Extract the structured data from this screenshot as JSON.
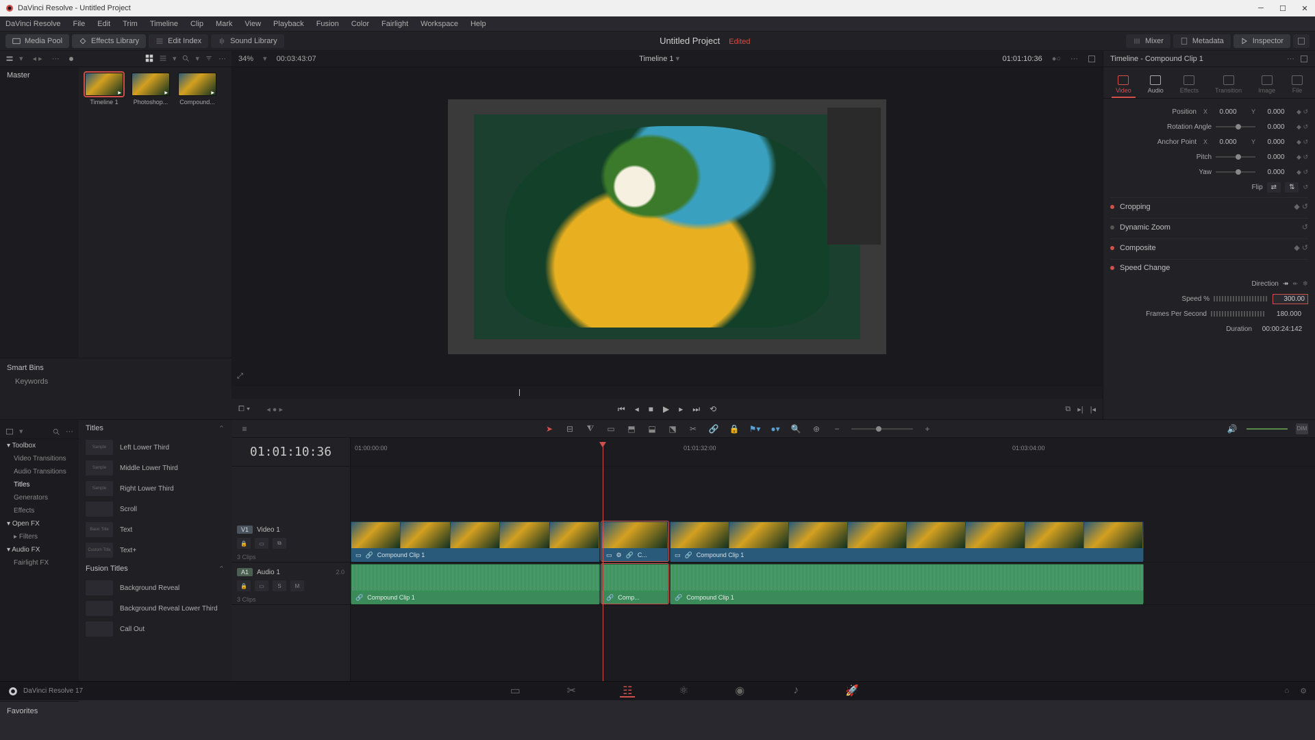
{
  "window": {
    "title": "DaVinci Resolve - Untitled Project"
  },
  "menus": [
    "DaVinci Resolve",
    "File",
    "Edit",
    "Trim",
    "Timeline",
    "Clip",
    "Mark",
    "View",
    "Playback",
    "Fusion",
    "Color",
    "Fairlight",
    "Workspace",
    "Help"
  ],
  "toolbar": {
    "media_pool": "Media Pool",
    "effects_library": "Effects Library",
    "edit_index": "Edit Index",
    "sound_library": "Sound Library",
    "project_title": "Untitled Project",
    "edited": "Edited",
    "mixer": "Mixer",
    "metadata": "Metadata",
    "inspector": "Inspector"
  },
  "media_pool": {
    "master": "Master",
    "zoom": "34%",
    "src_tc": "00:03:43:07",
    "clips": [
      {
        "name": "Timeline 1",
        "sel": true
      },
      {
        "name": "Photoshop..."
      },
      {
        "name": "Compound..."
      }
    ],
    "smartbins": "Smart Bins",
    "keywords": "Keywords"
  },
  "viewer": {
    "timeline_name": "Timeline 1",
    "rec_tc": "01:01:10:36"
  },
  "inspector": {
    "header": "Timeline - Compound Clip 1",
    "tabs": [
      "Video",
      "Audio",
      "Effects",
      "Transition",
      "Image",
      "File"
    ],
    "props": {
      "position": "Position",
      "pos_x": "0.000",
      "pos_y": "0.000",
      "rotation": "Rotation Angle",
      "rot_v": "0.000",
      "anchor": "Anchor Point",
      "anc_x": "0.000",
      "anc_y": "0.000",
      "pitch": "Pitch",
      "pitch_v": "0.000",
      "yaw": "Yaw",
      "yaw_v": "0.000",
      "flip": "Flip"
    },
    "sections": {
      "cropping": "Cropping",
      "dynamic_zoom": "Dynamic Zoom",
      "composite": "Composite",
      "speed_change": "Speed Change"
    },
    "speed": {
      "direction": "Direction",
      "speed_pct": "Speed %",
      "speed_val": "300.00",
      "fps": "Frames Per Second",
      "fps_val": "180.000",
      "duration": "Duration",
      "duration_val": "00:00:24:142"
    }
  },
  "fx": {
    "toolbox": "Toolbox",
    "tree": [
      "Video Transitions",
      "Audio Transitions",
      "Titles",
      "Generators",
      "Effects"
    ],
    "openfx": "Open FX",
    "filters": "Filters",
    "audiofx": "Audio FX",
    "fairlightfx": "Fairlight FX",
    "titles_hdr": "Titles",
    "titles_list": [
      "Left Lower Third",
      "Middle Lower Third",
      "Right Lower Third",
      "Scroll",
      "Text",
      "Text+"
    ],
    "fusion_titles": "Fusion Titles",
    "fusion_list": [
      "Background Reveal",
      "Background Reveal Lower Third",
      "Call Out"
    ],
    "favorites": "Favorites"
  },
  "timeline": {
    "tc": "01:01:10:36",
    "ruler": [
      "01:00:00:00",
      "01:01:32:00",
      "01:03:04:00"
    ],
    "v1": "Video 1",
    "v1_badge": "V1",
    "v1_meta": "3 Clips",
    "a1": "Audio 1",
    "a1_badge": "A1",
    "a1_ch": "2.0",
    "a1_meta": "3 Clips",
    "solo": "S",
    "mute": "M",
    "clip_name": "Compound Clip 1",
    "clip_name_short": "Comp...",
    "clip_name_short2": "C..."
  },
  "bottom": {
    "version": "DaVinci Resolve 17"
  }
}
